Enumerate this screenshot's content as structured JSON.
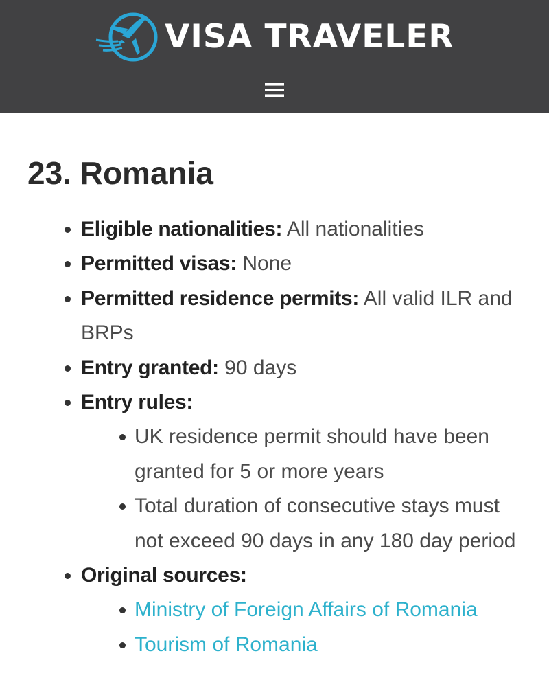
{
  "header": {
    "brand": "VISA TRAVELER",
    "logo_icon": "airplane-globe-icon",
    "menu_icon": "hamburger-menu-icon",
    "background_color": "#414143",
    "logo_accent_color": "#2aa6d6"
  },
  "section": {
    "number": "23.",
    "country": "Romania"
  },
  "facts": [
    {
      "label": "Eligible nationalities:",
      "value": "All nationalities"
    },
    {
      "label": "Permitted visas:",
      "value": "None"
    },
    {
      "label": "Permitted residence permits:",
      "value": "All valid ILR and BRPs"
    },
    {
      "label": "Entry granted:",
      "value": "90 days"
    }
  ],
  "entry_rules": {
    "label": "Entry rules:",
    "items": [
      "UK residence permit should have been granted for 5 or more years",
      "Total duration of consecutive stays must not exceed 90 days in any 180 day period"
    ]
  },
  "sources": {
    "label": "Original sources:",
    "links": [
      "Ministry of Foreign Affairs of Romania",
      "Tourism of Romania"
    ],
    "link_color": "#2db1cc"
  }
}
